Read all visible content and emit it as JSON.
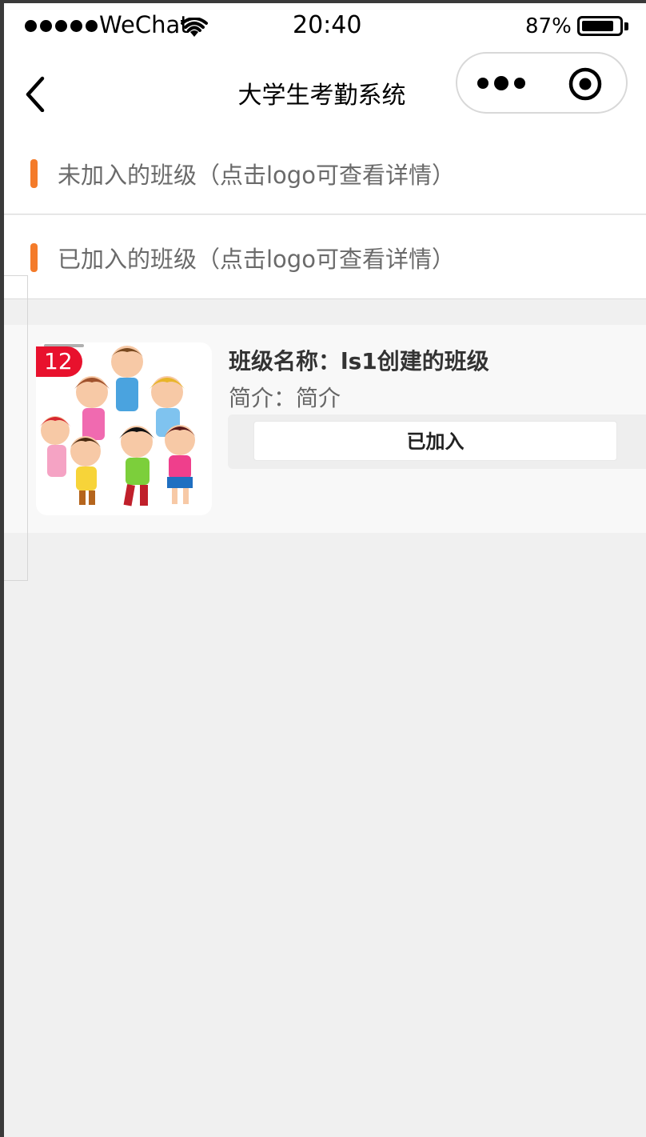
{
  "status_bar": {
    "carrier": "WeChat",
    "time": "20:40",
    "battery_percent": "87%",
    "battery_level": 0.87,
    "signal_icon": "signal-dots-icon",
    "wifi_icon": "wifi-icon"
  },
  "nav": {
    "title": "大学生考勤系统",
    "back_icon": "chevron-left-icon",
    "more_icon": "more-dots-icon",
    "close_icon": "target-close-icon"
  },
  "sections": {
    "not_joined": {
      "label": "未加入的班级（点击logo可查看详情）",
      "accent": "#f47b2a"
    },
    "joined": {
      "label": "已加入的班级（点击logo可查看详情）",
      "accent": "#f47b2a"
    }
  },
  "joined_classes": [
    {
      "badge": "12",
      "name": "班级名称：ls1创建的班级",
      "intro": "简介：简介",
      "button": "已加入",
      "logo_icon": "children-group-illustration"
    }
  ],
  "colors": {
    "accent": "#f47b2a",
    "badge": "#e8112d",
    "page_bg": "#f0f0f0"
  }
}
